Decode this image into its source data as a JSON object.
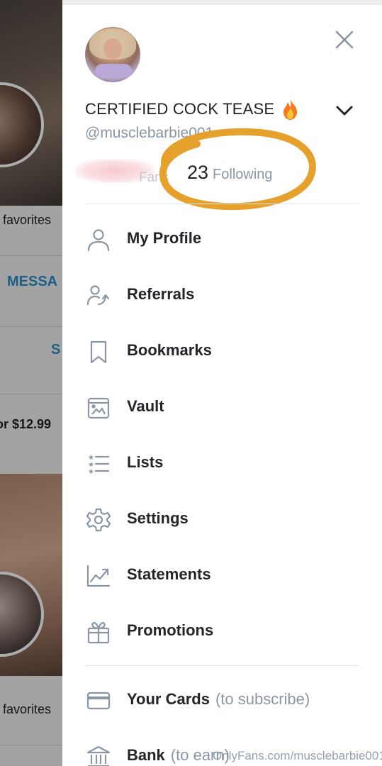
{
  "background_page": {
    "favorites_1": "favorites",
    "message_button": "MESSA",
    "subscribe_fragment": "S",
    "price": "or $12.99",
    "favorites_2": "favorites"
  },
  "drawer": {
    "display_name": "CERTIFIED COCK TEASE",
    "username": "@musclebarbie001",
    "fans_label": "Fans",
    "following_count": "23",
    "following_label": "Following",
    "menu": [
      {
        "label": "My Profile",
        "icon": "person-icon"
      },
      {
        "label": "Referrals",
        "icon": "referrals-icon"
      },
      {
        "label": "Bookmarks",
        "icon": "bookmark-icon"
      },
      {
        "label": "Vault",
        "icon": "vault-icon"
      },
      {
        "label": "Lists",
        "icon": "lists-icon"
      },
      {
        "label": "Settings",
        "icon": "gear-icon"
      },
      {
        "label": "Statements",
        "icon": "chart-icon"
      },
      {
        "label": "Promotions",
        "icon": "gift-icon"
      }
    ],
    "payment_menu": [
      {
        "label": "Your Cards",
        "sub": "(to subscribe)",
        "icon": "card-icon"
      },
      {
        "label": "Bank",
        "sub": "(to earn)",
        "icon": "bank-icon"
      }
    ]
  },
  "watermark": "OnlyFans.com/musclebarbie001",
  "colors": {
    "text_primary": "#242529",
    "text_secondary": "#8a96a3",
    "accent_blue": "#2b8ec7",
    "highlight_orange": "#e6a02c",
    "divider": "#e4e6e9"
  }
}
